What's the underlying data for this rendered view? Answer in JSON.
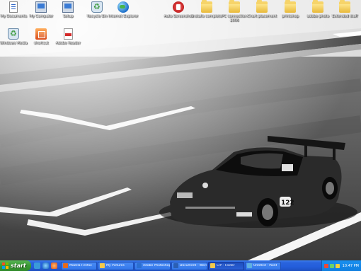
{
  "desktop": {
    "icons_row1": [
      {
        "name": "my-documents",
        "label": "My Documents",
        "icon": "doc-icon"
      },
      {
        "name": "my-computer",
        "label": "My Computer",
        "icon": "computer-icon"
      },
      {
        "name": "my-network",
        "label": "Setup",
        "icon": "computer-icon"
      },
      {
        "name": "recycle-bin",
        "label": "Recycle Bin",
        "icon": "recycle-icon"
      },
      {
        "name": "internet-explorer",
        "label": "Internet Explorer",
        "icon": "globe-icon"
      },
      {
        "name": "auto-screenshot",
        "label": "Auto Screenshot",
        "icon": "red-icon"
      },
      {
        "name": "folder-1",
        "label": "Installs complete",
        "icon": "folder-icon"
      },
      {
        "name": "folder-2",
        "label": "PC connection 2006",
        "icon": "folder-icon"
      },
      {
        "name": "folder-3",
        "label": "Chart placement",
        "icon": "folder-icon"
      },
      {
        "name": "folder-4",
        "label": "printshop",
        "icon": "folder-icon"
      },
      {
        "name": "folder-5",
        "label": "adobe photo",
        "icon": "folder-icon"
      },
      {
        "name": "folder-6",
        "label": "Extended stuff",
        "icon": "folder-icon"
      }
    ],
    "icons_row2": [
      {
        "name": "windows-media",
        "label": "Windows Media",
        "icon": "recycle-icon"
      },
      {
        "name": "app-shortcut",
        "label": "shortcut",
        "icon": "app-icon"
      },
      {
        "name": "pdf-file",
        "label": "Adobe Reader",
        "icon": "pdf-icon"
      }
    ]
  },
  "taskbar": {
    "start_label": "start",
    "windows": [
      {
        "label": "Mozilla Firefox",
        "color": "#e66a1a"
      },
      {
        "label": "My Pictures",
        "color": "#f2c94c"
      },
      {
        "label": "Adobe Photoshop",
        "color": "#2b6fd1"
      },
      {
        "label": "Document - Word",
        "color": "#2b5fb3"
      },
      {
        "label": "CIP - Folder",
        "color": "#f2c94c"
      },
      {
        "label": "Untitled - Paint",
        "color": "#5fb0e0"
      }
    ],
    "clock": "10:47 PM"
  }
}
